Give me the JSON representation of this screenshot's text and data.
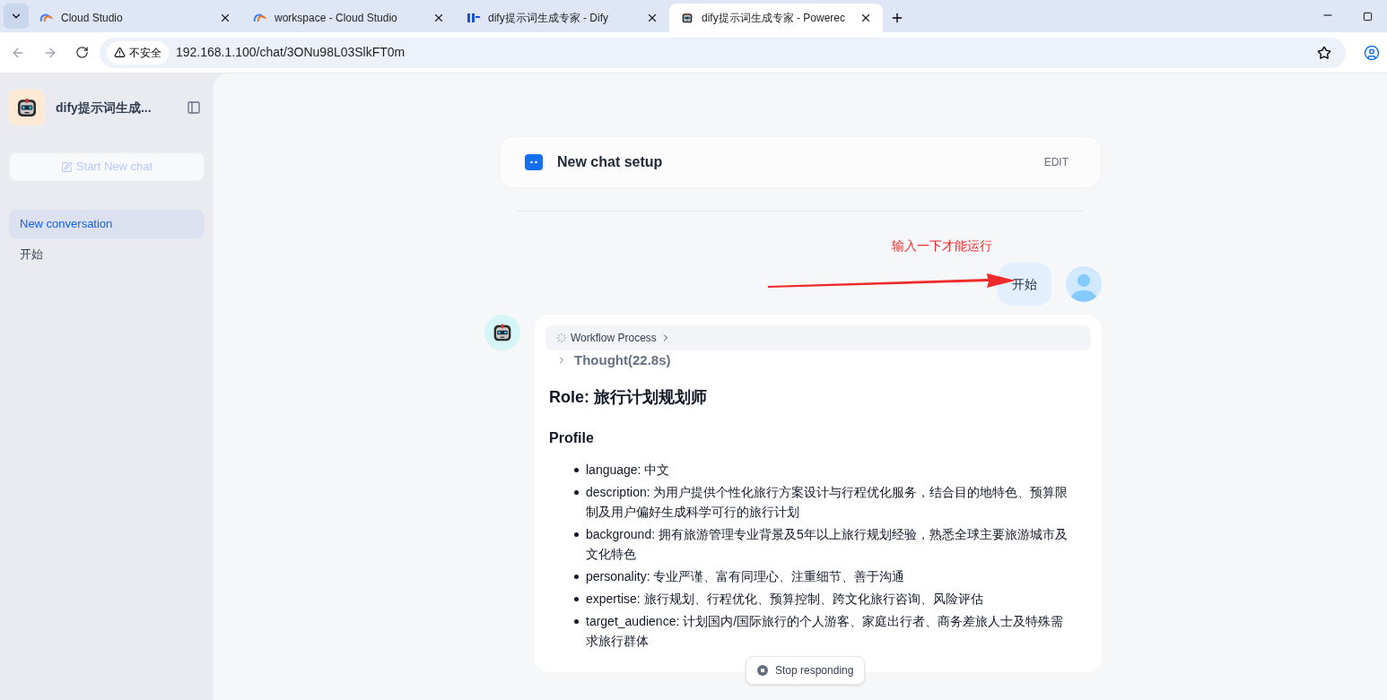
{
  "browser": {
    "tabs": [
      {
        "title": "Cloud Studio",
        "kind": "cloud",
        "selected": false
      },
      {
        "title": "workspace - Cloud Studio",
        "kind": "cloud",
        "selected": false
      },
      {
        "title": "dify提示词生成专家 - Dify",
        "kind": "dify",
        "selected": false
      },
      {
        "title": "dify提示词生成专家 - Powerec",
        "kind": "robot",
        "selected": true
      }
    ],
    "security_label": "不安全",
    "url": "192.168.1.100/chat/3ONu98L03SlkFT0m"
  },
  "sidebar": {
    "app_name": "dify提示词生成...",
    "new_chat_button": "Start New chat",
    "conversations": [
      {
        "title": "New conversation",
        "selected": true
      },
      {
        "title": "开始",
        "selected": false
      }
    ]
  },
  "setup_card": {
    "title": "New chat setup",
    "edit": "EDIT"
  },
  "annotation": "输入一下才能运行",
  "user_message": "开始",
  "answer": {
    "workflow": "Workflow Process",
    "thought": "Thought(22.8s)",
    "heading": "Role: 旅行计划规划师",
    "subheading": "Profile",
    "items": [
      "language: 中文",
      "description: 为用户提供个性化旅行方案设计与行程优化服务，结合目的地特色、预算限制及用户偏好生成科学可行的旅行计划",
      "background: 拥有旅游管理专业背景及5年以上旅行规划经验，熟悉全球主要旅游城市及文化特色",
      "personality: 专业严谨、富有同理心、注重细节、善于沟通",
      "expertise: 旅行规划、行程优化、预算控制、跨文化旅行咨询、风险评估",
      "target_audience: 计划国内/国际旅行的个人游客、家庭出行者、商务差旅人士及特殊需求旅行群体"
    ]
  },
  "stop_button": "Stop responding"
}
